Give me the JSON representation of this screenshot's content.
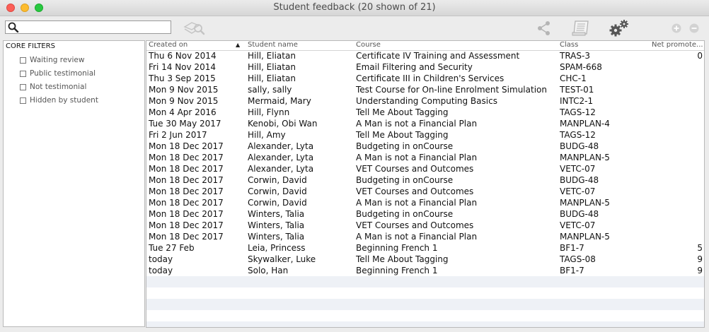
{
  "window": {
    "title": "Student feedback (20 shown of 21)"
  },
  "search": {
    "value": "",
    "placeholder": ""
  },
  "toolbar": {
    "icons": [
      "find-related-icon",
      "share-icon",
      "notes-icon",
      "gear-icon",
      "add-icon",
      "remove-icon"
    ]
  },
  "sidebar": {
    "title": "CORE FILTERS",
    "items": [
      {
        "label": "Waiting review",
        "checked": false
      },
      {
        "label": "Public testimonial",
        "checked": false
      },
      {
        "label": "Not testimonial",
        "checked": false
      },
      {
        "label": "Hidden by student",
        "checked": false
      }
    ]
  },
  "table": {
    "columns": [
      "Created on",
      "Student name",
      "Course",
      "Class",
      "Net promote..."
    ],
    "sort_column": "Created on",
    "sort_direction": "ascending",
    "rows": [
      [
        "Thu 6 Nov 2014",
        "Hill, Eliatan",
        "Certificate IV Training and Assessment",
        "TRAS-3",
        "0"
      ],
      [
        "Fri 14 Nov 2014",
        "Hill, Eliatan",
        "Email Filtering and Security",
        "SPAM-668",
        ""
      ],
      [
        "Thu 3 Sep 2015",
        "Hill, Eliatan",
        "Certificate III in Children's Services",
        "CHC-1",
        ""
      ],
      [
        "Mon 9 Nov 2015",
        "sally, sally",
        "Test Course for On-line Enrolment Simulation",
        "TEST-01",
        ""
      ],
      [
        "Mon 9 Nov 2015",
        "Mermaid, Mary",
        "Understanding Computing Basics",
        "INTC2-1",
        ""
      ],
      [
        "Mon 4 Apr 2016",
        "Hill, Flynn",
        "Tell Me About Tagging",
        "TAGS-12",
        ""
      ],
      [
        "Tue 30 May 2017",
        "Kenobi, Obi Wan",
        "A Man is not a Financial Plan",
        "MANPLAN-4",
        ""
      ],
      [
        "Fri 2 Jun 2017",
        "Hill, Amy",
        "Tell Me About Tagging",
        "TAGS-12",
        ""
      ],
      [
        "Mon 18 Dec 2017",
        "Alexander, Lyta",
        "Budgeting in onCourse",
        "BUDG-48",
        ""
      ],
      [
        "Mon 18 Dec 2017",
        "Alexander, Lyta",
        "A Man is not a Financial Plan",
        "MANPLAN-5",
        ""
      ],
      [
        "Mon 18 Dec 2017",
        "Alexander, Lyta",
        "VET Courses and Outcomes",
        "VETC-07",
        ""
      ],
      [
        "Mon 18 Dec 2017",
        "Corwin, David",
        "Budgeting in onCourse",
        "BUDG-48",
        ""
      ],
      [
        "Mon 18 Dec 2017",
        "Corwin, David",
        "VET Courses and Outcomes",
        "VETC-07",
        ""
      ],
      [
        "Mon 18 Dec 2017",
        "Corwin, David",
        "A Man is not a Financial Plan",
        "MANPLAN-5",
        ""
      ],
      [
        "Mon 18 Dec 2017",
        "Winters, Talia",
        "Budgeting in onCourse",
        "BUDG-48",
        ""
      ],
      [
        "Mon 18 Dec 2017",
        "Winters, Talia",
        "VET Courses and Outcomes",
        "VETC-07",
        ""
      ],
      [
        "Mon 18 Dec 2017",
        "Winters, Talia",
        "A Man is not a Financial Plan",
        "MANPLAN-5",
        ""
      ],
      [
        "Tue 27 Feb",
        "Leia, Princess",
        "Beginning French 1",
        "BF1-7",
        "5"
      ],
      [
        "today",
        "Skywalker, Luke",
        "Tell Me About Tagging",
        "TAGS-08",
        "9"
      ],
      [
        "today",
        "Solo, Han",
        "Beginning French 1",
        "BF1-7",
        "9"
      ]
    ],
    "empty_rows": 5
  },
  "colors": {
    "row_stripe": "#eef1f6",
    "close": "#fc5f57",
    "minimize": "#fdbc2e",
    "maximize": "#28c840"
  }
}
